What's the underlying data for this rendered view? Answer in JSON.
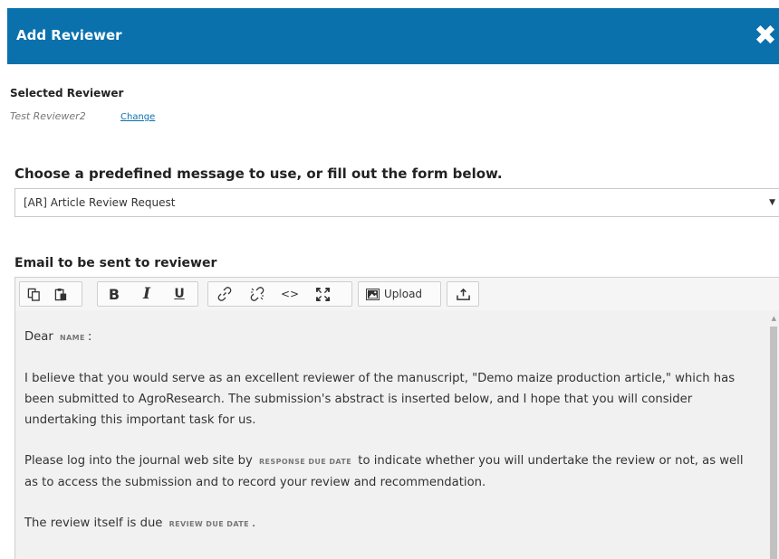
{
  "dialog": {
    "title": "Add Reviewer",
    "close_icon": "close-icon"
  },
  "selected_reviewer": {
    "heading": "Selected Reviewer",
    "name": "Test Reviewer2",
    "change_label": "Change"
  },
  "template": {
    "heading": "Choose a predefined message to use, or fill out the form below.",
    "selected": "[AR] Article Review Request",
    "arrow": "▼"
  },
  "email": {
    "heading": "Email to be sent to reviewer",
    "toolbar": {
      "copy_icon": "copy-icon",
      "paste_icon": "paste-icon",
      "bold_label": "B",
      "italic_label": "I",
      "underline_label": "U",
      "link_icon": "link-icon",
      "unlink_icon": "unlink-icon",
      "code_label": "<>",
      "fullscreen_icon": "fullscreen-icon",
      "upload_label": "Upload",
      "insert_icon": "insert-icon"
    },
    "body": {
      "p1_a": "Dear",
      "p1_tag": "NAME",
      "p1_b": ":",
      "p2": "I believe that you would serve as an excellent reviewer of the manuscript, \"Demo maize production article,\" which has been submitted to AgroResearch. The submission's abstract is inserted below, and I hope that you will consider undertaking this important task for us.",
      "p3_a": "Please log into the journal web site by",
      "p3_tag": "RESPONSE DUE DATE",
      "p3_b": "to indicate whether you will undertake the review or not, as well as to access the submission and to record your review and recommendation.",
      "p4_a": "The review itself is due",
      "p4_tag": "REVIEW DUE DATE",
      "p4_b": "."
    }
  },
  "colors": {
    "header_bg": "#0a71ad",
    "link": "#0a71ad",
    "editor_bg": "#f1f1f1"
  }
}
